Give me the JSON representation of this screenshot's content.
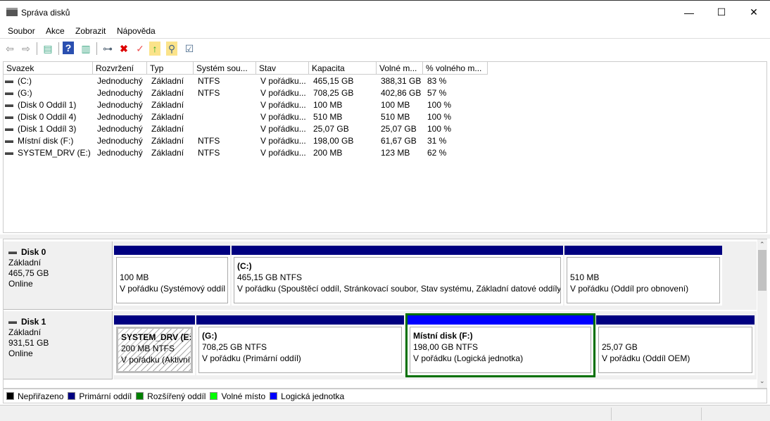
{
  "window": {
    "title": "Správa disků",
    "minimize": "—",
    "maximize": "☐",
    "close": "✕"
  },
  "menu": [
    "Soubor",
    "Akce",
    "Zobrazit",
    "Nápověda"
  ],
  "toolbar": [
    "back",
    "forward",
    "console-tree",
    "help",
    "action-pane",
    "connect",
    "delete",
    "properties",
    "export",
    "find",
    "list-settings"
  ],
  "columns": [
    "Svazek",
    "Rozvržení",
    "Typ",
    "Systém sou...",
    "Stav",
    "Kapacita",
    "Volné m...",
    "% volného m..."
  ],
  "volumes": [
    [
      "(C:)",
      "Jednoduchý",
      "Základní",
      "NTFS",
      "V pořádku...",
      "465,15 GB",
      "388,31 GB",
      "83 %"
    ],
    [
      "(G:)",
      "Jednoduchý",
      "Základní",
      "NTFS",
      "V pořádku...",
      "708,25 GB",
      "402,86 GB",
      "57 %"
    ],
    [
      "(Disk 0 Oddíl 1)",
      "Jednoduchý",
      "Základní",
      "",
      "V pořádku...",
      "100 MB",
      "100 MB",
      "100 %"
    ],
    [
      "(Disk 0 Oddíl 4)",
      "Jednoduchý",
      "Základní",
      "",
      "V pořádku...",
      "510 MB",
      "510 MB",
      "100 %"
    ],
    [
      "(Disk 1 Oddíl 3)",
      "Jednoduchý",
      "Základní",
      "",
      "V pořádku...",
      "25,07 GB",
      "25,07 GB",
      "100 %"
    ],
    [
      "Místní disk (F:)",
      "Jednoduchý",
      "Základní",
      "NTFS",
      "V pořádku...",
      "198,00 GB",
      "61,67 GB",
      "31 %"
    ],
    [
      "SYSTEM_DRV (E:)",
      "Jednoduchý",
      "Základní",
      "NTFS",
      "V pořádku...",
      "200 MB",
      "123 MB",
      "62 %"
    ]
  ],
  "disks": [
    {
      "name": "Disk 0",
      "type": "Základní",
      "size": "465,75 GB",
      "state": "Online",
      "partitions": [
        {
          "title": "",
          "size": "100 MB",
          "status": "V pořádku (Systémový oddíl"
        },
        {
          "title": "(C:)",
          "size": "465,15 GB NTFS",
          "status": "V pořádku (Spouštěcí oddíl, Stránkovací soubor, Stav systému, Základní datové oddíly)"
        },
        {
          "title": "",
          "size": "510 MB",
          "status": "V pořádku (Oddíl pro obnovení)"
        }
      ]
    },
    {
      "name": "Disk 1",
      "type": "Základní",
      "size": "931,51 GB",
      "state": "Online",
      "partitions": [
        {
          "title": "SYSTEM_DRV  (E:)",
          "size": "200 MB NTFS",
          "status": "V pořádku (Aktivní,"
        },
        {
          "title": "(G:)",
          "size": "708,25 GB NTFS",
          "status": "V pořádku (Primární oddíl)"
        },
        {
          "title": "Místní disk  (F:)",
          "size": "198,00 GB NTFS",
          "status": "V pořádku (Logická jednotka)"
        },
        {
          "title": "",
          "size": "25,07 GB",
          "status": "V pořádku (Oddíl OEM)"
        }
      ]
    }
  ],
  "legend": [
    {
      "label": "Nepřiřazeno",
      "color": "#000000"
    },
    {
      "label": "Primární oddíl",
      "color": "#000080"
    },
    {
      "label": "Rozšířený oddíl",
      "color": "#008000"
    },
    {
      "label": "Volné místo",
      "color": "#00ff00"
    },
    {
      "label": "Logická jednotka",
      "color": "#0000ff"
    }
  ]
}
